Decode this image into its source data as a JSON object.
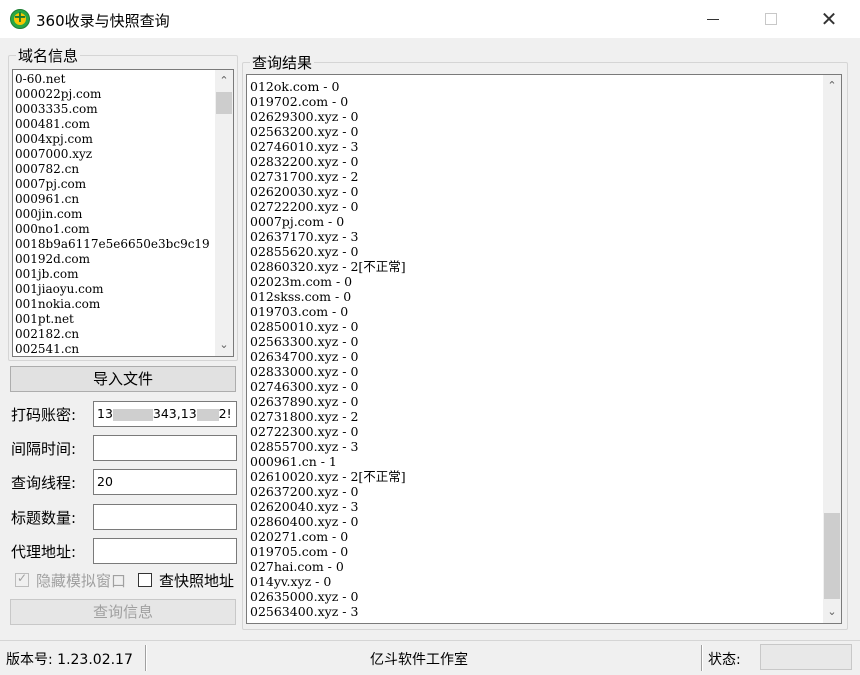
{
  "window": {
    "title": "360收录与快照查询",
    "minimize_glyph": "—",
    "maximize_glyph": "☐",
    "close_glyph": "✕"
  },
  "domain_group": {
    "label": "域名信息",
    "items": [
      "0-60.net",
      "000022pj.com",
      "0003335.com",
      "000481.com",
      "0004xpj.com",
      "0007000.xyz",
      "000782.cn",
      "0007pj.com",
      "000961.cn",
      "000jin.com",
      "000no1.com",
      "0018b9a6117e5e6650e3bc9c19",
      "00192d.com",
      "001jb.com",
      "001jiaoyu.com",
      "001nokia.com",
      "001pt.net",
      "002182.cn",
      "002541.cn"
    ]
  },
  "result_group": {
    "label": "查询结果",
    "items": [
      "012ok.com - 0",
      "019702.com - 0",
      "02629300.xyz - 0",
      "02563200.xyz - 0",
      "02746010.xyz - 3",
      "02832200.xyz - 0",
      "02731700.xyz - 2",
      "02620030.xyz - 0",
      "02722200.xyz - 0",
      "0007pj.com - 0",
      "02637170.xyz - 3",
      "02855620.xyz - 0",
      "02860320.xyz - 2[不正常]",
      "02023m.com - 0",
      "012skss.com - 0",
      "019703.com - 0",
      "02850010.xyz - 0",
      "02563300.xyz - 0",
      "02634700.xyz - 0",
      "02833000.xyz - 0",
      "02746300.xyz - 0",
      "02637890.xyz - 0",
      "02731800.xyz - 2",
      "02722300.xyz - 0",
      "02855700.xyz - 3",
      "000961.cn - 1",
      "02610020.xyz - 2[不正常]",
      "02637200.xyz - 0",
      "02620040.xyz - 3",
      "02860400.xyz - 0",
      "020271.com - 0",
      "019705.com - 0",
      "027hai.com - 0",
      "014yv.xyz - 0",
      "02635000.xyz - 0",
      "02563400.xyz - 3"
    ]
  },
  "buttons": {
    "import_file": "导入文件",
    "query_info": "查询信息"
  },
  "fields": {
    "captcha_account": {
      "label": "打码账密:",
      "value_start": "13",
      "value_mid": "343,13",
      "value_end": "2!"
    },
    "interval": {
      "label": "间隔时间:",
      "value": ""
    },
    "threads": {
      "label": "查询线程:",
      "value": "20"
    },
    "title_count": {
      "label": "标题数量:",
      "value": ""
    },
    "proxy": {
      "label": "代理地址:",
      "value": ""
    }
  },
  "checkboxes": {
    "hide_window": {
      "label": "隐藏模拟窗口",
      "checked": true,
      "enabled": false
    },
    "check_snapshot": {
      "label": "查快照地址",
      "checked": false,
      "enabled": true
    }
  },
  "statusbar": {
    "version": "版本号: 1.23.02.17",
    "studio": "亿斗软件工作室",
    "status_label": "状态:",
    "status_value": ""
  },
  "scroll_glyphs": {
    "up": "⌃",
    "down": "⌄"
  }
}
